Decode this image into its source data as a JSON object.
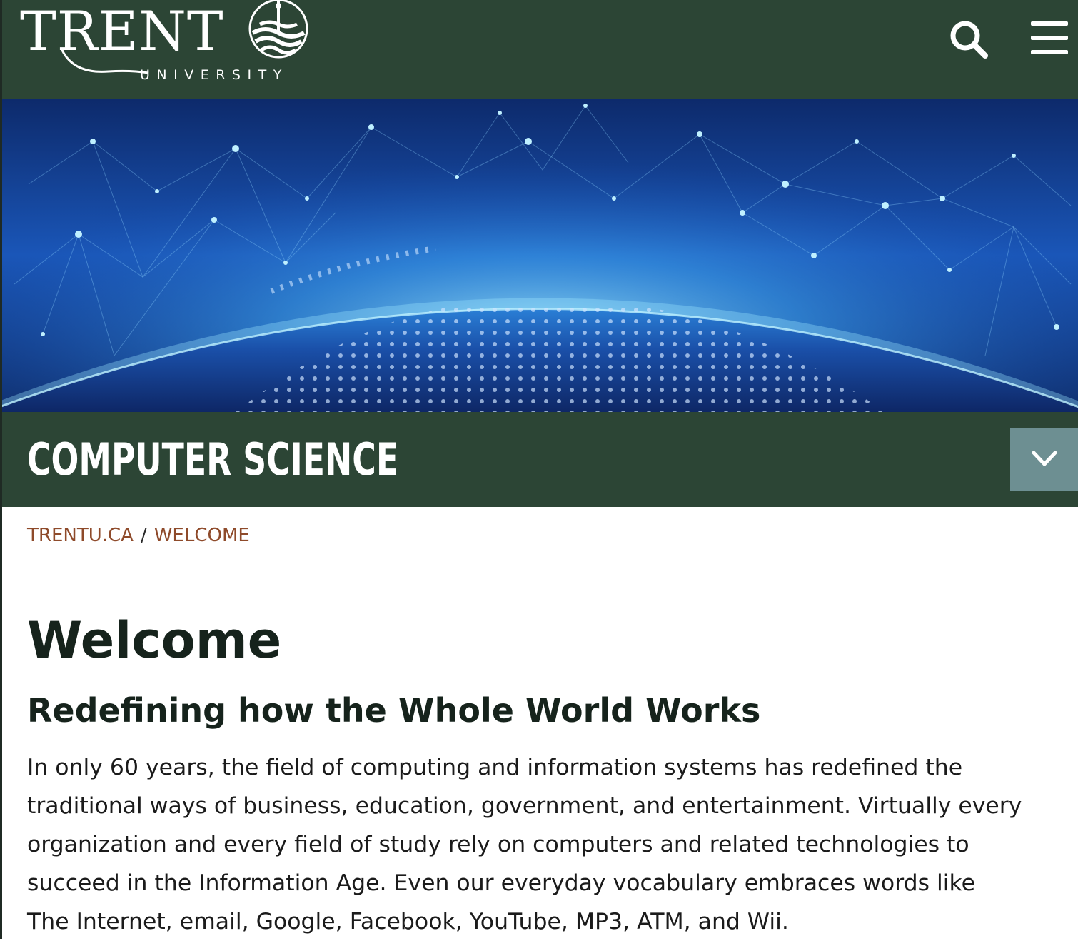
{
  "header": {
    "logo_word": "TRENT",
    "logo_sub": "UNIVERSITY",
    "search_icon": "search-icon",
    "menu_icon": "hamburger-menu-icon",
    "bg_color": "#2c4535"
  },
  "banner": {
    "image": "glowing network globe"
  },
  "department": {
    "title": "COMPUTER SCIENCE",
    "toggle_icon": "chevron-down-icon",
    "toggle_color": "#6d8f92"
  },
  "breadcrumb": {
    "items": [
      {
        "label": "TRENTU.CA"
      },
      {
        "label": "WELCOME"
      }
    ],
    "separator": "/",
    "link_color": "#8e4a2a"
  },
  "content": {
    "title": "Welcome",
    "subtitle": "Redefining how the Whole World Works",
    "paragraph_lines": [
      "In only 60 years, the field of computing and information systems has redefined the",
      "traditional ways of business, education, government, and entertainment.  Virtually every",
      "organization and every field of study rely on computers and related technologies to",
      "succeed in the Information Age.  Even our everyday vocabulary embraces words like",
      "The Internet, email, Google, Facebook, YouTube, MP3, ATM, and Wii."
    ]
  }
}
